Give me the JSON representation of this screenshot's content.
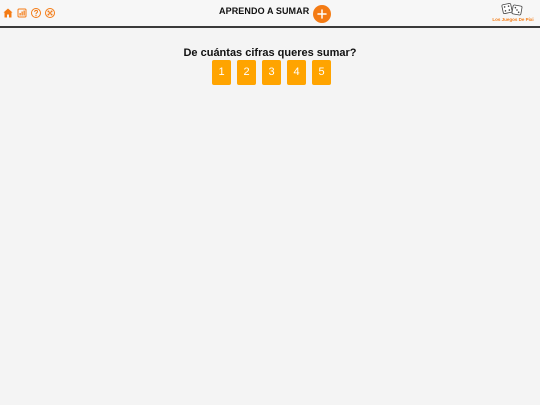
{
  "header": {
    "title": "APRENDO A SUMAR",
    "left_icons": [
      "home-icon",
      "stats-icon",
      "help-icon",
      "fullscreen-icon"
    ],
    "brand": {
      "name": "Los Juegos De Pixi",
      "icon": "dice-icon"
    },
    "action_icon": "plus-circle-icon"
  },
  "main": {
    "question": "De cuántas cifras queres sumar?",
    "options": [
      "1",
      "2",
      "3",
      "4",
      "5"
    ]
  },
  "colors": {
    "accent": "#f47b14",
    "option_button": "#ffa400",
    "background": "#f4f4f4",
    "topbar_border": "#3a3a3a"
  }
}
